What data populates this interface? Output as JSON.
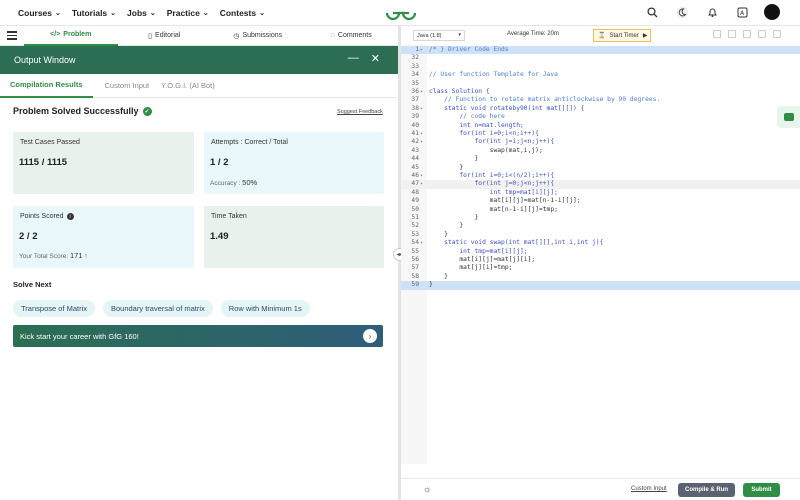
{
  "topnav": {
    "items": [
      "Courses",
      "Tutorials",
      "Jobs",
      "Practice",
      "Contests"
    ]
  },
  "problem_tabs": [
    {
      "label": "Problem",
      "icon": "</>"
    },
    {
      "label": "Editorial",
      "icon": "▯"
    },
    {
      "label": "Submissions",
      "icon": "◷"
    },
    {
      "label": "Comments",
      "icon": "◌"
    }
  ],
  "output": {
    "title": "Output Window",
    "tabs": [
      "Compilation Results",
      "Custom Input",
      "Y.O.G.I. (AI Bot)"
    ],
    "status": "Problem Solved Successfully",
    "feedback": "Suggest Feedback",
    "cards": {
      "tests_label": "Test Cases Passed",
      "tests_value": "1115 / 1115",
      "attempts_label": "Attempts : Correct / Total",
      "attempts_value": "1 / 2",
      "accuracy_label": "Accuracy :",
      "accuracy_value": "50%",
      "points_label": "Points Scored",
      "points_value": "2 / 2",
      "total_score_label": "Your Total Score:",
      "total_score_value": "171",
      "time_label": "Time Taken",
      "time_value": "1.49"
    },
    "solve_next_title": "Solve Next",
    "solve_next": [
      "Transpose of Matrix",
      "Boundary traversal of matrix",
      "Row with Minimum 1s"
    ],
    "banner": "Kick start your career with GfG 160!"
  },
  "editor": {
    "language": "Java (1.8)",
    "avg_time": "Average Time: 20m",
    "timer_label": "Start Timer",
    "lines": [
      {
        "n": "1",
        "fold": "▸",
        "code": "/* } Driver Code Ends",
        "cls": "c-com",
        "hl": "hl"
      },
      {
        "n": "32",
        "fold": "",
        "code": "",
        "cls": "c-pl",
        "hl": ""
      },
      {
        "n": "33",
        "fold": "",
        "code": "",
        "cls": "c-pl",
        "hl": ""
      },
      {
        "n": "34",
        "fold": "",
        "code": "// User function Template for Java",
        "cls": "c-com",
        "hl": ""
      },
      {
        "n": "35",
        "fold": "",
        "code": "",
        "cls": "c-pl",
        "hl": ""
      },
      {
        "n": "36",
        "fold": "▾",
        "code": "class Solution {",
        "cls": "c-kw",
        "hl": ""
      },
      {
        "n": "37",
        "fold": "",
        "code": "    // Function to rotate matrix anticlockwise by 90 degrees.",
        "cls": "c-com",
        "hl": ""
      },
      {
        "n": "38",
        "fold": "▾",
        "code": "    static void rotateby90(int mat[][]) {",
        "cls": "c-kw",
        "hl": ""
      },
      {
        "n": "39",
        "fold": "",
        "code": "        // code here",
        "cls": "c-com",
        "hl": ""
      },
      {
        "n": "40",
        "fold": "",
        "code": "        int n=mat.length;",
        "cls": "c-kw",
        "hl": ""
      },
      {
        "n": "41",
        "fold": "▾",
        "code": "        for(int i=0;i<n;i++){",
        "cls": "c-kw",
        "hl": ""
      },
      {
        "n": "42",
        "fold": "▾",
        "code": "            for(int j=i;j<n;j++){",
        "cls": "c-kw",
        "hl": ""
      },
      {
        "n": "43",
        "fold": "",
        "code": "                swap(mat,i,j);",
        "cls": "c-pl",
        "hl": ""
      },
      {
        "n": "44",
        "fold": "",
        "code": "            }",
        "cls": "c-pl",
        "hl": ""
      },
      {
        "n": "45",
        "fold": "",
        "code": "        }",
        "cls": "c-pl",
        "hl": ""
      },
      {
        "n": "46",
        "fold": "▾",
        "code": "        for(int i=0;i<(n/2);i++){",
        "cls": "c-kw",
        "hl": ""
      },
      {
        "n": "47",
        "fold": "▾",
        "code": "            for(int j=0;j<n;j++){",
        "cls": "c-kw",
        "hl": "cur"
      },
      {
        "n": "48",
        "fold": "",
        "code": "                int tmp=mat[i][j];",
        "cls": "c-kw",
        "hl": ""
      },
      {
        "n": "49",
        "fold": "",
        "code": "                mat[i][j]=mat[n-1-i][j];",
        "cls": "c-pl",
        "hl": ""
      },
      {
        "n": "50",
        "fold": "",
        "code": "                mat[n-1-i][j]=tmp;",
        "cls": "c-pl",
        "hl": ""
      },
      {
        "n": "51",
        "fold": "",
        "code": "            }",
        "cls": "c-pl",
        "hl": ""
      },
      {
        "n": "52",
        "fold": "",
        "code": "        }",
        "cls": "c-pl",
        "hl": ""
      },
      {
        "n": "53",
        "fold": "",
        "code": "    }",
        "cls": "c-pl",
        "hl": ""
      },
      {
        "n": "54",
        "fold": "▾",
        "code": "    static void swap(int mat[][],int i,int j){",
        "cls": "c-kw",
        "hl": ""
      },
      {
        "n": "55",
        "fold": "",
        "code": "        int tmp=mat[i][j];",
        "cls": "c-kw",
        "hl": ""
      },
      {
        "n": "56",
        "fold": "",
        "code": "        mat[i][j]=mat[j][i];",
        "cls": "c-pl",
        "hl": ""
      },
      {
        "n": "57",
        "fold": "",
        "code": "        mat[j][i]=tmp;",
        "cls": "c-pl",
        "hl": ""
      },
      {
        "n": "58",
        "fold": "",
        "code": "    }",
        "cls": "c-pl",
        "hl": ""
      },
      {
        "n": "59",
        "fold": "",
        "code": "}",
        "cls": "c-pl",
        "hl": "hl"
      }
    ]
  },
  "bottom": {
    "custom_input": "Custom Input",
    "compile_run": "Compile & Run",
    "submit": "Submit"
  },
  "colors": {
    "brand_green": "#2f8d46",
    "header_green": "#2b6e53",
    "card_green": "#e9f1ec",
    "card_blue": "#e9f7fb"
  }
}
